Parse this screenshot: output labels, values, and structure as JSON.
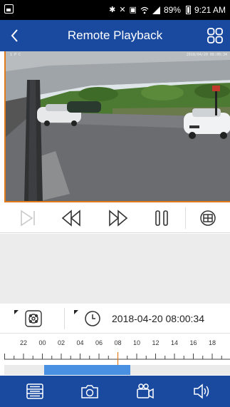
{
  "status_bar": {
    "icons": [
      "gallery-icon",
      "bluetooth-icon",
      "mute-icon",
      "nfc-icon",
      "wifi-icon",
      "signal-icon"
    ],
    "battery_percent": "89%",
    "time": "9:21 AM"
  },
  "header": {
    "title": "Remote Playback",
    "back_icon": "chevron-left-icon",
    "layout_icon": "grid-2x2-icon"
  },
  "video": {
    "osd_left": "1  P C",
    "osd_right": "2018/04/20  08:00:34"
  },
  "controls": {
    "buttons": [
      "skip-next-icon",
      "rewind-icon",
      "fast-forward-icon",
      "pause-icon",
      "capture-window-icon"
    ],
    "skip_disabled": true
  },
  "info": {
    "date_time": "2018-04-20 08:00:34",
    "left_icon": "record-type-icon",
    "clock_icon": "clock-icon"
  },
  "timeline": {
    "labels": [
      "22",
      "00",
      "02",
      "04",
      "06",
      "08",
      "10",
      "12",
      "14",
      "16",
      "18"
    ],
    "cursor_color": "#e07a1a",
    "record_color": "#4a90e2",
    "recording_start_hour": 0.2,
    "recording_end_hour": 9.3
  },
  "bottom_bar": {
    "buttons": [
      "record-list-icon",
      "camera-icon",
      "video-record-icon",
      "speaker-icon"
    ]
  },
  "colors": {
    "brand": "#1a4aa0",
    "accent": "#e07a1a",
    "recording": "#4a90e2"
  }
}
